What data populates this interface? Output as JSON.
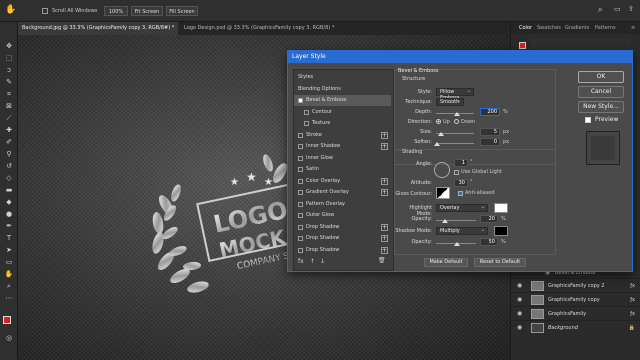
{
  "options_bar": {
    "scroll_all_windows": "Scroll All Windows",
    "zoom": "100%",
    "fit_screen": "Fit Screen",
    "fill_screen": "Fill Screen"
  },
  "tabs": [
    {
      "label": "Background.jpg @ 33.3% (GraphicsFamily copy 3, RGB/8#) *",
      "close": "×"
    },
    {
      "label": "Logo Design.psd @ 33.3% (GraphicsFamily copy 3, RGB/8) *",
      "close": "×"
    }
  ],
  "right_panel": {
    "tabs": [
      "Color",
      "Swatches",
      "Gradients",
      "Patterns"
    ],
    "layers": [
      {
        "name": "Bevel & Emboss",
        "kind": "effect"
      },
      {
        "name": "GraphicsFamily copy 2",
        "kind": "layer"
      },
      {
        "name": "GraphicsFamily copy",
        "kind": "layer"
      },
      {
        "name": "GraphicsFamily",
        "kind": "layer"
      },
      {
        "name": "Background",
        "kind": "locked"
      }
    ]
  },
  "canvas": {
    "logo_line1": "LOGO",
    "logo_line2": "MOCK",
    "logo_line3": "COMPANY S"
  },
  "dialog": {
    "title": "Layer Style",
    "styles_list": [
      {
        "label": "Styles",
        "check": false,
        "plus": false,
        "header": true
      },
      {
        "label": "Blending Options",
        "check": false,
        "plus": false,
        "header": true
      },
      {
        "label": "Bevel & Emboss",
        "check": true,
        "plus": false,
        "selected": true
      },
      {
        "label": "Contour",
        "check": false,
        "plus": false,
        "indent": true
      },
      {
        "label": "Texture",
        "check": false,
        "plus": false,
        "indent": true
      },
      {
        "label": "Stroke",
        "check": false,
        "plus": true
      },
      {
        "label": "Inner Shadow",
        "check": false,
        "plus": true
      },
      {
        "label": "Inner Glow",
        "check": false,
        "plus": false
      },
      {
        "label": "Satin",
        "check": false,
        "plus": false
      },
      {
        "label": "Color Overlay",
        "check": false,
        "plus": true
      },
      {
        "label": "Gradient Overlay",
        "check": false,
        "plus": true
      },
      {
        "label": "Pattern Overlay",
        "check": false,
        "plus": false
      },
      {
        "label": "Outer Glow",
        "check": false,
        "plus": false
      },
      {
        "label": "Drop Shadow",
        "check": false,
        "plus": true
      },
      {
        "label": "Drop Shadow",
        "check": false,
        "plus": true
      },
      {
        "label": "Drop Shadow",
        "check": false,
        "plus": true
      }
    ],
    "footer_icons": [
      "fx",
      "↑",
      "↓",
      "🗑"
    ],
    "section_title": "Bevel & Emboss",
    "structure": {
      "heading": "Structure",
      "style_label": "Style:",
      "style_value": "Pillow Emboss",
      "technique_label": "Technique:",
      "technique_value": "Smooth",
      "depth_label": "Depth:",
      "depth_value": "200",
      "depth_unit": "%",
      "direction_label": "Direction:",
      "direction_up": "Up",
      "direction_down": "Down",
      "size_label": "Size:",
      "size_value": "5",
      "size_unit": "px",
      "soften_label": "Soften:",
      "soften_value": "0",
      "soften_unit": "px"
    },
    "shading": {
      "heading": "Shading",
      "angle_label": "Angle:",
      "angle_value": "1",
      "angle_unit": "°",
      "global_light_label": "Use Global Light",
      "altitude_label": "Altitude:",
      "altitude_value": "30",
      "altitude_unit": "°",
      "gloss_label": "Gloss Contour:",
      "antialiased_label": "Anti-aliased",
      "highlight_label": "Highlight Mode:",
      "highlight_value": "Overlay",
      "highlight_opacity_label": "Opacity:",
      "highlight_opacity": "20",
      "highlight_opacity_unit": "%",
      "shadow_label": "Shadow Mode:",
      "shadow_value": "Multiply",
      "shadow_opacity_label": "Opacity:",
      "shadow_opacity": "50",
      "shadow_opacity_unit": "%"
    },
    "make_default": "Make Default",
    "reset_default": "Reset to Default",
    "ok": "OK",
    "cancel": "Cancel",
    "new_style": "New Style...",
    "preview": "Preview"
  },
  "colors": {
    "accent": "#2a6bd1",
    "foreground_swatch": "#e02020",
    "highlight_color": "#ffffff",
    "shadow_color": "#000000"
  }
}
